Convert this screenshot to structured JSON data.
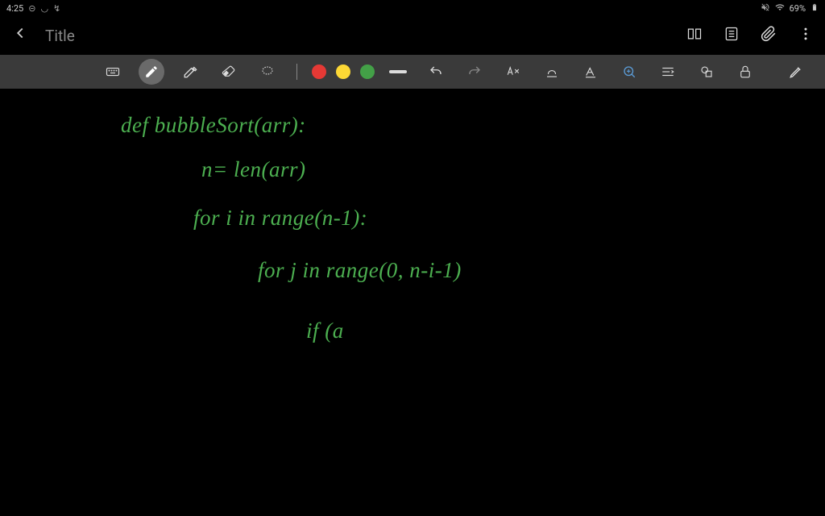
{
  "status_bar": {
    "time": "4:25",
    "battery": "69%"
  },
  "header": {
    "title": "Title"
  },
  "toolbar": {
    "selected_tool": "highlighter",
    "colors": {
      "red": "#e53935",
      "yellow": "#fdd835",
      "green": "#43a047"
    }
  },
  "handwriting": {
    "line1": "def  bubbleSort(arr):",
    "line2": "n= len(arr)",
    "line3": "for i in range(n-1):",
    "line4": "for j in range(0, n-i-1)",
    "line5": "if (a"
  }
}
